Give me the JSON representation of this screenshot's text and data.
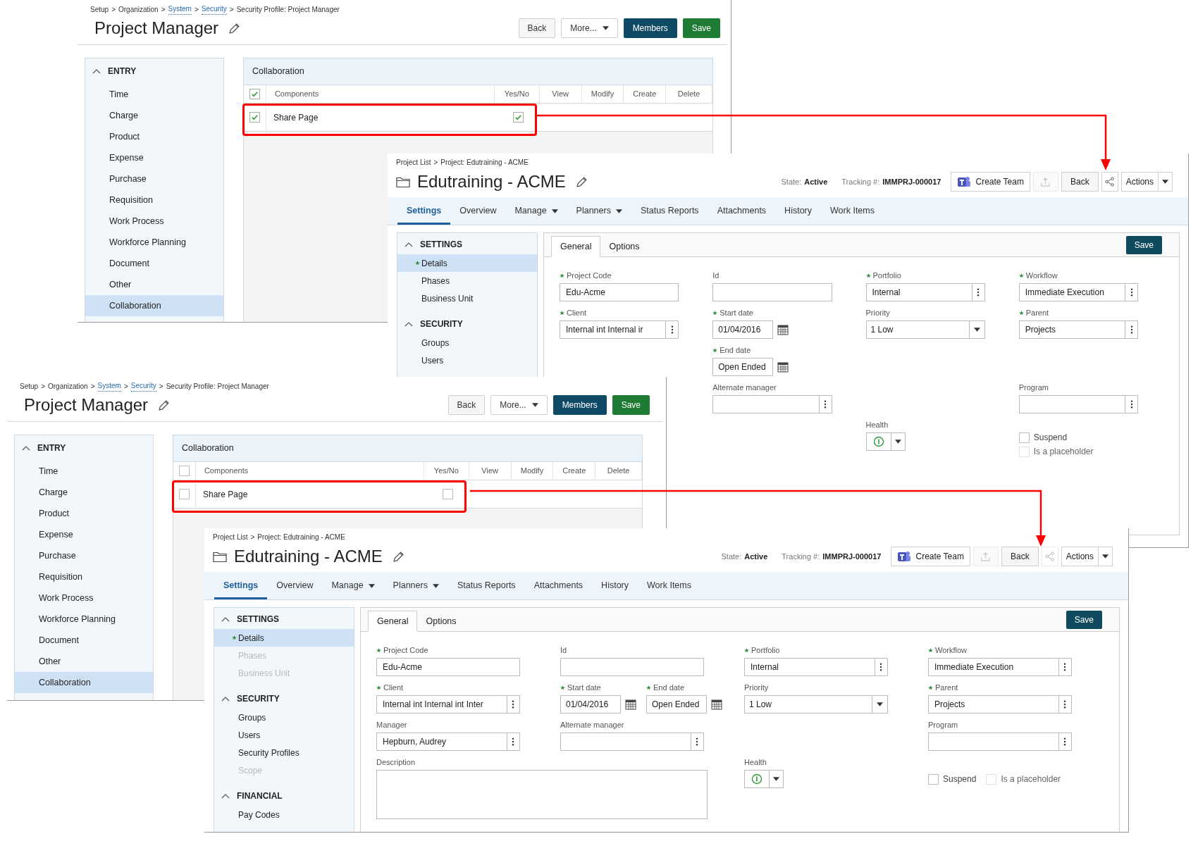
{
  "windows": [
    {
      "kind": "security_profile",
      "breadcrumb": {
        "separator": ">",
        "items": [
          {
            "text": "Setup",
            "link": false
          },
          {
            "text": "Organization",
            "link": false
          },
          {
            "text": "System",
            "link": true
          },
          {
            "text": "Security",
            "link": true
          },
          {
            "text": "Security Profile: Project Manager",
            "link": false
          }
        ]
      },
      "title": "Project Manager",
      "buttons": [
        {
          "label": "Back",
          "kind": "plain"
        },
        {
          "label": "More...",
          "kind": "menu"
        },
        {
          "label": "Members",
          "kind": "primary"
        },
        {
          "label": "Save",
          "kind": "success"
        }
      ],
      "sidebar": {
        "title": "ENTRY",
        "expanded": true,
        "items": [
          {
            "label": "Time",
            "selected": false
          },
          {
            "label": "Charge",
            "selected": false
          },
          {
            "label": "Product",
            "selected": false
          },
          {
            "label": "Expense",
            "selected": false
          },
          {
            "label": "Purchase",
            "selected": false
          },
          {
            "label": "Requisition",
            "selected": false
          },
          {
            "label": "Work Process",
            "selected": false
          },
          {
            "label": "Workforce Planning",
            "selected": false
          },
          {
            "label": "Document",
            "selected": false
          },
          {
            "label": "Other",
            "selected": false
          },
          {
            "label": "Collaboration",
            "selected": true
          }
        ]
      },
      "panel": {
        "title": "Collaboration",
        "all_checked": true,
        "columns": [
          "Components",
          "Yes/No",
          "View",
          "Modify",
          "Create",
          "Delete"
        ],
        "rows": [
          {
            "label": "Share Page",
            "checked": true,
            "yes_no": true
          }
        ]
      }
    },
    {
      "kind": "project",
      "breadcrumb": {
        "separator": ">",
        "items": [
          {
            "text": "Project List",
            "link": false
          },
          {
            "text": "Project: Edutraining - ACME",
            "link": false
          }
        ]
      },
      "title": "Edutraining - ACME",
      "state_label": "State:",
      "state": "Active",
      "tracking_label": "Tracking #:",
      "tracking": "IMMPRJ-000017",
      "actions": [
        {
          "kind": "teams",
          "label": "Create Team"
        },
        {
          "kind": "upload",
          "disabled": true
        },
        {
          "kind": "plain",
          "label": "Back"
        },
        {
          "kind": "share",
          "disabled": false
        },
        {
          "kind": "split",
          "label": "Actions"
        }
      ],
      "nav": [
        {
          "label": "Settings",
          "selected": true,
          "menu": false
        },
        {
          "label": "Overview",
          "selected": false,
          "menu": false
        },
        {
          "label": "Manage",
          "selected": false,
          "menu": true
        },
        {
          "label": "Planners",
          "selected": false,
          "menu": true
        },
        {
          "label": "Status Reports",
          "selected": false,
          "menu": false
        },
        {
          "label": "Attachments",
          "selected": false,
          "menu": false
        },
        {
          "label": "History",
          "selected": false,
          "menu": false
        },
        {
          "label": "Work Items",
          "selected": false,
          "menu": false
        }
      ],
      "sidebar": [
        {
          "title": "SETTINGS",
          "expanded": true,
          "items": [
            {
              "label": "Details",
              "selected": true,
              "starred": true,
              "disabled": false
            },
            {
              "label": "Phases",
              "selected": false,
              "starred": false,
              "disabled": false
            },
            {
              "label": "Business Unit",
              "selected": false,
              "starred": false,
              "disabled": false
            }
          ]
        },
        {
          "title": "SECURITY",
          "expanded": true,
          "items": [
            {
              "label": "Groups",
              "selected": false,
              "starred": false,
              "disabled": false
            },
            {
              "label": "Users",
              "selected": false,
              "starred": false,
              "disabled": false
            }
          ]
        }
      ],
      "subtabs": [
        {
          "label": "General",
          "selected": true
        },
        {
          "label": "Options",
          "selected": false
        }
      ],
      "save": "Save",
      "form": [
        [
          {
            "kind": "stack",
            "fields": [
              {
                "kind": "text",
                "label": "Project Code",
                "required": true,
                "value": "Edu-Acme"
              }
            ]
          },
          {
            "kind": "stack",
            "fields": [
              {
                "kind": "text",
                "label": "Id",
                "required": false
              }
            ]
          },
          {
            "kind": "stack",
            "fields": [
              {
                "kind": "lookup",
                "label": "Portfolio",
                "required": true,
                "value": "Internal"
              }
            ]
          },
          {
            "kind": "stack",
            "fields": [
              {
                "kind": "lookup",
                "label": "Workflow",
                "required": true,
                "value": "Immediate Execution"
              }
            ]
          }
        ],
        [
          {
            "kind": "stack",
            "fields": [
              {
                "kind": "lookup",
                "label": "Client",
                "required": true,
                "value": "Internal int Internal ir"
              }
            ]
          },
          {
            "kind": "stack",
            "fields": [
              {
                "kind": "date",
                "label": "Start date",
                "required": true,
                "value": "01/04/2016"
              }
            ]
          },
          {
            "kind": "stack",
            "fields": [
              {
                "kind": "select",
                "label": "Priority",
                "required": false,
                "value": "1 Low"
              }
            ]
          },
          {
            "kind": "stack",
            "fields": [
              {
                "kind": "lookup",
                "label": "Parent",
                "required": true,
                "value": "Projects"
              }
            ]
          }
        ],
        [
          {
            "kind": "blank"
          },
          {
            "kind": "stack",
            "fields": [
              {
                "kind": "date",
                "label": "End date",
                "required": true,
                "value": "Open Ended"
              }
            ]
          },
          {
            "kind": "blank"
          },
          {
            "kind": "blank"
          }
        ],
        [
          {
            "kind": "blank"
          },
          {
            "kind": "stack",
            "fields": [
              {
                "kind": "lookup",
                "label": "Alternate manager",
                "required": false
              }
            ]
          },
          {
            "kind": "blank"
          },
          {
            "kind": "stack",
            "fields": [
              {
                "kind": "lookup",
                "label": "Program",
                "required": false
              }
            ]
          }
        ],
        [
          {
            "kind": "blank"
          },
          {
            "kind": "blank"
          },
          {
            "kind": "stack",
            "fields": [
              {
                "kind": "health",
                "label": "Health",
                "required": false
              }
            ]
          },
          {
            "kind": "stack",
            "fields": [
              {
                "kind": "checkbox",
                "label": "Suspend",
                "checked": false,
                "disabled": false
              },
              {
                "kind": "checkbox",
                "label": "Is a placeholder",
                "checked": false,
                "disabled": true
              }
            ]
          }
        ]
      ]
    },
    {
      "kind": "security_profile",
      "breadcrumb": {
        "separator": ">",
        "items": [
          {
            "text": "Setup",
            "link": false
          },
          {
            "text": "Organization",
            "link": false
          },
          {
            "text": "System",
            "link": true
          },
          {
            "text": "Security",
            "link": true
          },
          {
            "text": "Security Profile: Project Manager",
            "link": false
          }
        ]
      },
      "title": "Project Manager",
      "buttons": [
        {
          "label": "Back",
          "kind": "plain"
        },
        {
          "label": "More...",
          "kind": "menu"
        },
        {
          "label": "Members",
          "kind": "primary"
        },
        {
          "label": "Save",
          "kind": "success"
        }
      ],
      "sidebar": {
        "title": "ENTRY",
        "expanded": true,
        "items": [
          {
            "label": "Time",
            "selected": false
          },
          {
            "label": "Charge",
            "selected": false
          },
          {
            "label": "Product",
            "selected": false
          },
          {
            "label": "Expense",
            "selected": false
          },
          {
            "label": "Purchase",
            "selected": false
          },
          {
            "label": "Requisition",
            "selected": false
          },
          {
            "label": "Work Process",
            "selected": false
          },
          {
            "label": "Workforce Planning",
            "selected": false
          },
          {
            "label": "Document",
            "selected": false
          },
          {
            "label": "Other",
            "selected": false
          },
          {
            "label": "Collaboration",
            "selected": true
          }
        ]
      },
      "panel": {
        "title": "Collaboration",
        "all_checked": false,
        "columns": [
          "Components",
          "Yes/No",
          "View",
          "Modify",
          "Create",
          "Delete"
        ],
        "rows": [
          {
            "label": "Share Page",
            "checked": false,
            "yes_no": false
          }
        ]
      }
    },
    {
      "kind": "project",
      "breadcrumb": {
        "separator": ">",
        "items": [
          {
            "text": "Project List",
            "link": false
          },
          {
            "text": "Project: Edutraining - ACME",
            "link": false
          }
        ]
      },
      "title": "Edutraining - ACME",
      "state_label": "State:",
      "state": "Active",
      "tracking_label": "Tracking #:",
      "tracking": "IMMPRJ-000017",
      "actions": [
        {
          "kind": "teams",
          "label": "Create Team"
        },
        {
          "kind": "upload",
          "disabled": true
        },
        {
          "kind": "plain",
          "label": "Back"
        },
        {
          "kind": "share",
          "disabled": true
        },
        {
          "kind": "split",
          "label": "Actions"
        }
      ],
      "nav": [
        {
          "label": "Settings",
          "selected": true,
          "menu": false
        },
        {
          "label": "Overview",
          "selected": false,
          "menu": false
        },
        {
          "label": "Manage",
          "selected": false,
          "menu": true
        },
        {
          "label": "Planners",
          "selected": false,
          "menu": true
        },
        {
          "label": "Status Reports",
          "selected": false,
          "menu": false
        },
        {
          "label": "Attachments",
          "selected": false,
          "menu": false
        },
        {
          "label": "History",
          "selected": false,
          "menu": false
        },
        {
          "label": "Work Items",
          "selected": false,
          "menu": false
        }
      ],
      "sidebar": [
        {
          "title": "SETTINGS",
          "expanded": true,
          "items": [
            {
              "label": "Details",
              "selected": true,
              "starred": true,
              "disabled": false
            },
            {
              "label": "Phases",
              "selected": false,
              "starred": false,
              "disabled": true
            },
            {
              "label": "Business Unit",
              "selected": false,
              "starred": false,
              "disabled": true
            }
          ]
        },
        {
          "title": "SECURITY",
          "expanded": true,
          "items": [
            {
              "label": "Groups",
              "selected": false,
              "starred": false,
              "disabled": false
            },
            {
              "label": "Users",
              "selected": false,
              "starred": false,
              "disabled": false
            },
            {
              "label": "Security Profiles",
              "selected": false,
              "starred": false,
              "disabled": false
            },
            {
              "label": "Scope",
              "selected": false,
              "starred": false,
              "disabled": true
            }
          ]
        },
        {
          "title": "FINANCIAL",
          "expanded": true,
          "items": [
            {
              "label": "Pay Codes",
              "selected": false,
              "starred": false,
              "disabled": false
            }
          ]
        }
      ],
      "subtabs": [
        {
          "label": "General",
          "selected": true
        },
        {
          "label": "Options",
          "selected": false
        }
      ],
      "save": "Save",
      "form": [
        [
          {
            "kind": "stack",
            "fields": [
              {
                "kind": "text",
                "label": "Project Code",
                "required": true,
                "value": "Edu-Acme"
              }
            ]
          },
          {
            "kind": "stack",
            "fields": [
              {
                "kind": "text",
                "label": "Id",
                "required": false
              }
            ]
          },
          {
            "kind": "stack",
            "fields": [
              {
                "kind": "lookup",
                "label": "Portfolio",
                "required": true,
                "value": "Internal"
              }
            ]
          },
          {
            "kind": "stack",
            "fields": [
              {
                "kind": "lookup",
                "label": "Workflow",
                "required": true,
                "value": "Immediate Execution"
              }
            ]
          }
        ],
        [
          {
            "kind": "stack",
            "fields": [
              {
                "kind": "lookup",
                "label": "Client",
                "required": true,
                "value": "Internal int Internal int Inter"
              }
            ]
          },
          {
            "kind": "inline",
            "fields": [
              {
                "kind": "date",
                "label": "Start date",
                "required": true,
                "value": "01/04/2016"
              },
              {
                "kind": "date",
                "label": "End date",
                "required": true,
                "value": "Open Ended"
              }
            ]
          },
          {
            "kind": "stack",
            "fields": [
              {
                "kind": "select",
                "label": "Priority",
                "required": false,
                "value": "1 Low"
              }
            ]
          },
          {
            "kind": "stack",
            "fields": [
              {
                "kind": "lookup",
                "label": "Parent",
                "required": true,
                "value": "Projects"
              }
            ]
          }
        ],
        [
          {
            "kind": "stack",
            "fields": [
              {
                "kind": "lookup",
                "label": "Manager",
                "required": false,
                "value": "Hepburn, Audrey"
              }
            ]
          },
          {
            "kind": "stack",
            "fields": [
              {
                "kind": "lookup",
                "label": "Alternate manager",
                "required": false
              }
            ]
          },
          {
            "kind": "blank"
          },
          {
            "kind": "stack",
            "fields": [
              {
                "kind": "lookup",
                "label": "Program",
                "required": false
              }
            ]
          }
        ],
        [
          {
            "kind": "wide",
            "fields": [
              {
                "kind": "textarea",
                "label": "Description",
                "required": false
              }
            ]
          },
          {
            "kind": "stack",
            "fields": [
              {
                "kind": "health",
                "label": "Health",
                "required": false
              }
            ]
          },
          {
            "kind": "inline",
            "fields": [
              {
                "kind": "checkbox",
                "label": "Suspend",
                "checked": false,
                "disabled": false
              },
              {
                "kind": "checkbox",
                "label": "Is a placeholder",
                "checked": false,
                "disabled": true
              }
            ]
          }
        ]
      ]
    }
  ]
}
